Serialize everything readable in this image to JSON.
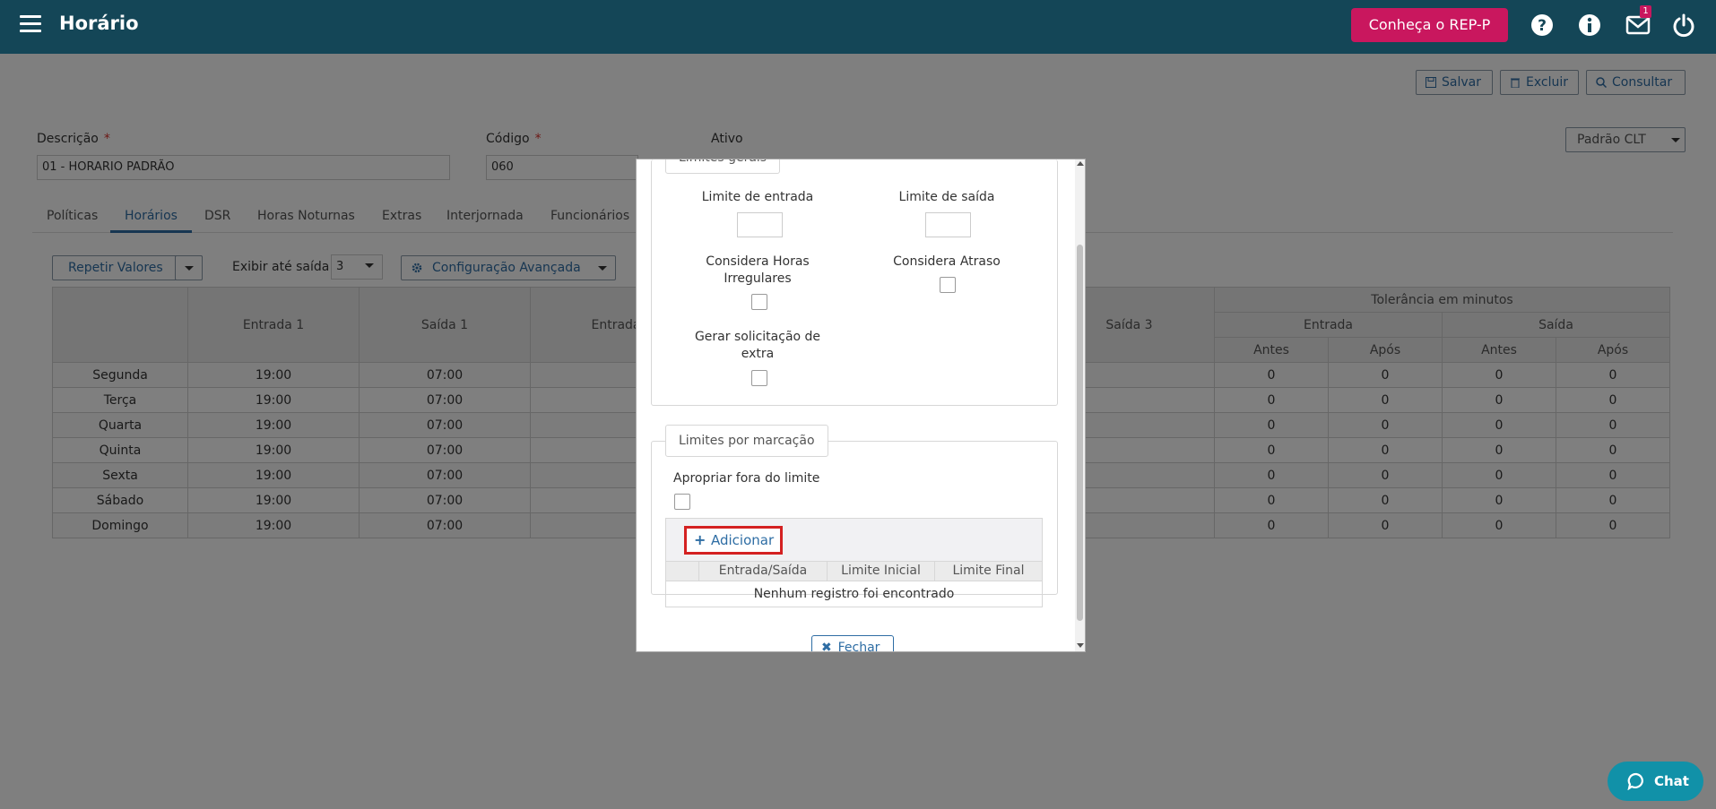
{
  "app": {
    "title": "Horário",
    "cta_label": "Conheça o REP-P",
    "notifications_count": "1"
  },
  "toolbar": {
    "save_label": "Salvar",
    "delete_label": "Excluir",
    "consult_label": "Consultar"
  },
  "form": {
    "description_label": "Descrição",
    "description_value": "01 - HORARIO PADRÃO",
    "code_label": "Código",
    "code_value": "060",
    "active_label": "Ativo",
    "required_mark": "*",
    "profile_select": "Padrão CLT"
  },
  "tabs": [
    "Políticas",
    "Horários",
    "DSR",
    "Horas Noturnas",
    "Extras",
    "Interjornada",
    "Funcionários"
  ],
  "grid_toolbar": {
    "repeat_label": "Repetir Valores",
    "show_until_label": "Exibir até saída:",
    "show_until_value": "3",
    "advanced_label": "Configuração Avançada"
  },
  "grid": {
    "headers": {
      "entrada1": "Entrada 1",
      "saida1": "Saída 1",
      "entrada2": "Entrada",
      "saida3": "Saída 3",
      "tolerancia": "Tolerância em minutos",
      "entrada": "Entrada",
      "saida": "Saída",
      "antes": "Antes",
      "apos": "Após"
    },
    "rows": [
      {
        "day": "Segunda",
        "e1": "19:00",
        "s1": "07:00",
        "t": [
          "0",
          "0",
          "0",
          "0"
        ]
      },
      {
        "day": "Terça",
        "e1": "19:00",
        "s1": "07:00",
        "t": [
          "0",
          "0",
          "0",
          "0"
        ]
      },
      {
        "day": "Quarta",
        "e1": "19:00",
        "s1": "07:00",
        "t": [
          "0",
          "0",
          "0",
          "0"
        ]
      },
      {
        "day": "Quinta",
        "e1": "19:00",
        "s1": "07:00",
        "t": [
          "0",
          "0",
          "0",
          "0"
        ]
      },
      {
        "day": "Sexta",
        "e1": "19:00",
        "s1": "07:00",
        "t": [
          "0",
          "0",
          "0",
          "0"
        ]
      },
      {
        "day": "Sábado",
        "e1": "19:00",
        "s1": "07:00",
        "t": [
          "0",
          "0",
          "0",
          "0"
        ]
      },
      {
        "day": "Domingo",
        "e1": "19:00",
        "s1": "07:00",
        "t": [
          "0",
          "0",
          "0",
          "0"
        ]
      }
    ]
  },
  "modal": {
    "general_legend": "Limites gerais",
    "entry_limit_label": "Limite de entrada",
    "exit_limit_label": "Limite de saída",
    "irregular_hours_label": "Considera Horas Irregulares",
    "late_label": "Considera Atraso",
    "overtime_request_label": "Gerar solicitação de extra",
    "per_mark_legend": "Limites por marcação",
    "out_of_limit_label": "Apropriar fora do limite",
    "add_label": "Adicionar",
    "columns": [
      "Entrada/Saída",
      "Limite Inicial",
      "Limite Final"
    ],
    "empty_message": "Nenhum registro foi encontrado",
    "close_label": "Fechar"
  },
  "chat": {
    "label": "Chat"
  },
  "colors": {
    "header_bg": "#144657",
    "cta_bg": "#c9175e",
    "accent": "#2e6da4",
    "highlight_border": "#d42121",
    "chat_bg": "#1191a8"
  }
}
